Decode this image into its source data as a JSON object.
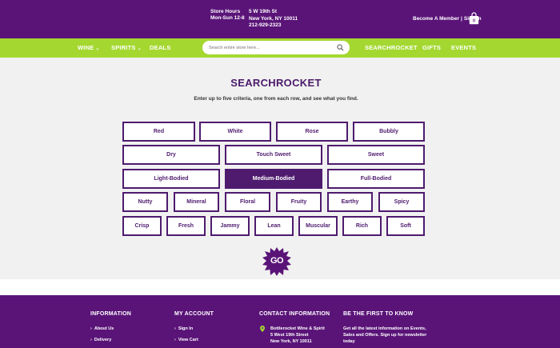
{
  "header": {
    "hours_label": "Store Hours",
    "hours_value": "Mon-Sun 12-8",
    "address_line1": "5 W 19th St",
    "address_line2": "New York, NY 10011",
    "phone": "212-929-2323",
    "become_member": "Become A Member",
    "separator": "|",
    "sign_in": "Sign In",
    "bag_icon": "shopping-bag-icon"
  },
  "nav": {
    "wine": "WINE",
    "spirits": "SPIRITS",
    "deals": "DEALS",
    "search_placeholder": "Search entire store here...",
    "searchrocket": "SEARCHROCKET",
    "gifts": "GIFTS",
    "events": "EVENTS",
    "chevron": "⌄"
  },
  "main": {
    "title": "SEARCHROCKET",
    "subtitle": "Enter up to five criteria, one from each row, and see what you find.",
    "rows": [
      [
        "Red",
        "White",
        "Rose",
        "Bubbly"
      ],
      [
        "Dry",
        "Touch Sweet",
        "Sweet"
      ],
      [
        "Light-Bodied",
        "Medium-Bodied",
        "Full-Bodied"
      ],
      [
        "Nutty",
        "Mineral",
        "Floral",
        "Fruity",
        "Earthy",
        "Spicy"
      ],
      [
        "Crisp",
        "Fresh",
        "Jammy",
        "Lean",
        "Muscular",
        "Rich",
        "Soft"
      ]
    ],
    "selected": "Medium-Bodied",
    "go_label": "GO",
    "colors": {
      "purple": "#5a1478",
      "green": "#a4d831",
      "button_border": "#4e1b6e"
    }
  },
  "footer": {
    "information": {
      "heading": "INFORMATION",
      "links": [
        "About Us",
        "Delivery"
      ]
    },
    "account": {
      "heading": "MY ACCOUNT",
      "links": [
        "Sign In",
        "View Cart"
      ]
    },
    "contact": {
      "heading": "CONTACT INFORMATION",
      "lines": [
        "Bottlerocket Wine & Spirit",
        "5 West 19th Street",
        "New York, NY 10011"
      ]
    },
    "newsletter": {
      "heading": "BE THE FIRST TO KNOW",
      "lines": [
        "Get all the latest information on Events,",
        "Sales and Offers. Sign up for newsletter",
        "today"
      ]
    },
    "arrow": "›"
  }
}
